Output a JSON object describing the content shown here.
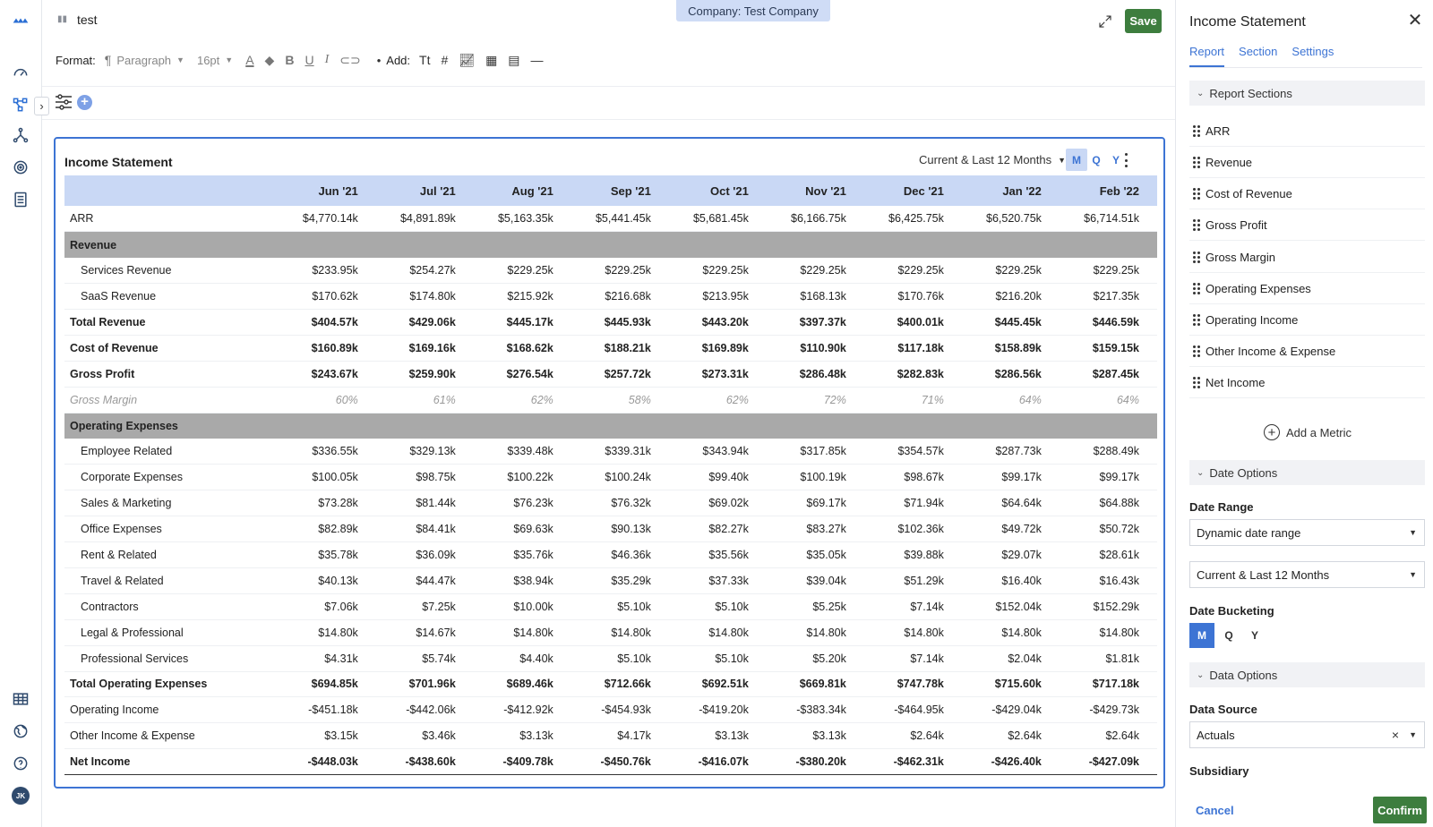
{
  "doc": {
    "title": "test",
    "company_pill": "Company: Test Company",
    "save_label": "Save"
  },
  "toolbar": {
    "format_label": "Format:",
    "paragraph": "Paragraph",
    "font_size": "16pt",
    "add_label": "Add:"
  },
  "report": {
    "title": "Income Statement",
    "range": "Current & Last 12 Months",
    "buckets": [
      "M",
      "Q",
      "Y"
    ],
    "active_bucket": "M",
    "columns": [
      "",
      "Jun '21",
      "Jul '21",
      "Aug '21",
      "Sep '21",
      "Oct '21",
      "Nov '21",
      "Dec '21",
      "Jan '22",
      "Feb '22"
    ],
    "rows": [
      {
        "type": "plain",
        "cells": [
          "ARR",
          "$4,770.14k",
          "$4,891.89k",
          "$5,163.35k",
          "$5,441.45k",
          "$5,681.45k",
          "$6,166.75k",
          "$6,425.75k",
          "$6,520.75k",
          "$6,714.51k"
        ]
      },
      {
        "type": "section",
        "cells": [
          "Revenue",
          "",
          "",
          "",
          "",
          "",
          "",
          "",
          "",
          ""
        ]
      },
      {
        "type": "sub",
        "cells": [
          "Services Revenue",
          "$233.95k",
          "$254.27k",
          "$229.25k",
          "$229.25k",
          "$229.25k",
          "$229.25k",
          "$229.25k",
          "$229.25k",
          "$229.25k"
        ]
      },
      {
        "type": "sub",
        "cells": [
          "SaaS Revenue",
          "$170.62k",
          "$174.80k",
          "$215.92k",
          "$216.68k",
          "$213.95k",
          "$168.13k",
          "$170.76k",
          "$216.20k",
          "$217.35k"
        ]
      },
      {
        "type": "total",
        "cells": [
          "Total Revenue",
          "$404.57k",
          "$429.06k",
          "$445.17k",
          "$445.93k",
          "$443.20k",
          "$397.37k",
          "$400.01k",
          "$445.45k",
          "$446.59k"
        ]
      },
      {
        "type": "bold",
        "cells": [
          "Cost of Revenue",
          "$160.89k",
          "$169.16k",
          "$168.62k",
          "$188.21k",
          "$169.89k",
          "$110.90k",
          "$117.18k",
          "$158.89k",
          "$159.15k"
        ]
      },
      {
        "type": "bold",
        "cells": [
          "Gross Profit",
          "$243.67k",
          "$259.90k",
          "$276.54k",
          "$257.72k",
          "$273.31k",
          "$286.48k",
          "$282.83k",
          "$286.56k",
          "$287.45k"
        ]
      },
      {
        "type": "pct",
        "cells": [
          "Gross Margin",
          "60%",
          "61%",
          "62%",
          "58%",
          "62%",
          "72%",
          "71%",
          "64%",
          "64%"
        ]
      },
      {
        "type": "section",
        "cells": [
          "Operating Expenses",
          "",
          "",
          "",
          "",
          "",
          "",
          "",
          "",
          ""
        ]
      },
      {
        "type": "sub",
        "cells": [
          "Employee Related",
          "$336.55k",
          "$329.13k",
          "$339.48k",
          "$339.31k",
          "$343.94k",
          "$317.85k",
          "$354.57k",
          "$287.73k",
          "$288.49k"
        ]
      },
      {
        "type": "sub",
        "cells": [
          "Corporate Expenses",
          "$100.05k",
          "$98.75k",
          "$100.22k",
          "$100.24k",
          "$99.40k",
          "$100.19k",
          "$98.67k",
          "$99.17k",
          "$99.17k"
        ]
      },
      {
        "type": "sub",
        "cells": [
          "Sales & Marketing",
          "$73.28k",
          "$81.44k",
          "$76.23k",
          "$76.32k",
          "$69.02k",
          "$69.17k",
          "$71.94k",
          "$64.64k",
          "$64.88k"
        ]
      },
      {
        "type": "sub",
        "cells": [
          "Office Expenses",
          "$82.89k",
          "$84.41k",
          "$69.63k",
          "$90.13k",
          "$82.27k",
          "$83.27k",
          "$102.36k",
          "$49.72k",
          "$50.72k"
        ]
      },
      {
        "type": "sub",
        "cells": [
          "Rent & Related",
          "$35.78k",
          "$36.09k",
          "$35.76k",
          "$46.36k",
          "$35.56k",
          "$35.05k",
          "$39.88k",
          "$29.07k",
          "$28.61k"
        ]
      },
      {
        "type": "sub",
        "cells": [
          "Travel & Related",
          "$40.13k",
          "$44.47k",
          "$38.94k",
          "$35.29k",
          "$37.33k",
          "$39.04k",
          "$51.29k",
          "$16.40k",
          "$16.43k"
        ]
      },
      {
        "type": "sub",
        "cells": [
          "Contractors",
          "$7.06k",
          "$7.25k",
          "$10.00k",
          "$5.10k",
          "$5.10k",
          "$5.25k",
          "$7.14k",
          "$152.04k",
          "$152.29k"
        ]
      },
      {
        "type": "sub",
        "cells": [
          "Legal & Professional",
          "$14.80k",
          "$14.67k",
          "$14.80k",
          "$14.80k",
          "$14.80k",
          "$14.80k",
          "$14.80k",
          "$14.80k",
          "$14.80k"
        ]
      },
      {
        "type": "sub",
        "cells": [
          "Professional Services",
          "$4.31k",
          "$5.74k",
          "$4.40k",
          "$5.10k",
          "$5.10k",
          "$5.20k",
          "$7.14k",
          "$2.04k",
          "$1.81k"
        ]
      },
      {
        "type": "total",
        "cells": [
          "Total Operating Expenses",
          "$694.85k",
          "$701.96k",
          "$689.46k",
          "$712.66k",
          "$692.51k",
          "$669.81k",
          "$747.78k",
          "$715.60k",
          "$717.18k"
        ]
      },
      {
        "type": "plain",
        "cells": [
          "Operating Income",
          "-$451.18k",
          "-$442.06k",
          "-$412.92k",
          "-$454.93k",
          "-$419.20k",
          "-$383.34k",
          "-$464.95k",
          "-$429.04k",
          "-$429.73k"
        ]
      },
      {
        "type": "plain",
        "cells": [
          "Other Income & Expense",
          "$3.15k",
          "$3.46k",
          "$3.13k",
          "$4.17k",
          "$3.13k",
          "$3.13k",
          "$2.64k",
          "$2.64k",
          "$2.64k"
        ]
      },
      {
        "type": "total last",
        "cells": [
          "Net Income",
          "-$448.03k",
          "-$438.60k",
          "-$409.78k",
          "-$450.76k",
          "-$416.07k",
          "-$380.20k",
          "-$462.31k",
          "-$426.40k",
          "-$427.09k"
        ]
      }
    ]
  },
  "panel": {
    "title": "Income Statement",
    "tabs": [
      "Report",
      "Section",
      "Settings"
    ],
    "report_sections_label": "Report Sections",
    "sections": [
      "ARR",
      "Revenue",
      "Cost of Revenue",
      "Gross Profit",
      "Gross Margin",
      "Operating Expenses",
      "Operating Income",
      "Other Income & Expense",
      "Net Income"
    ],
    "add_metric": "Add a Metric",
    "date_options_label": "Date Options",
    "date_range_label": "Date Range",
    "date_range_value": "Dynamic date range",
    "date_range_period": "Current & Last 12 Months",
    "date_bucketing_label": "Date Bucketing",
    "bucketing": [
      "M",
      "Q",
      "Y"
    ],
    "data_options_label": "Data Options",
    "data_source_label": "Data Source",
    "data_source_value": "Actuals",
    "subsidiary_label": "Subsidiary",
    "cancel_label": "Cancel",
    "confirm_label": "Confirm"
  },
  "colors": {
    "accent": "#3d74d4",
    "save_green": "#3d7d3e",
    "header_blue": "#c9d8f5",
    "section_gray": "#a9a9a9"
  }
}
